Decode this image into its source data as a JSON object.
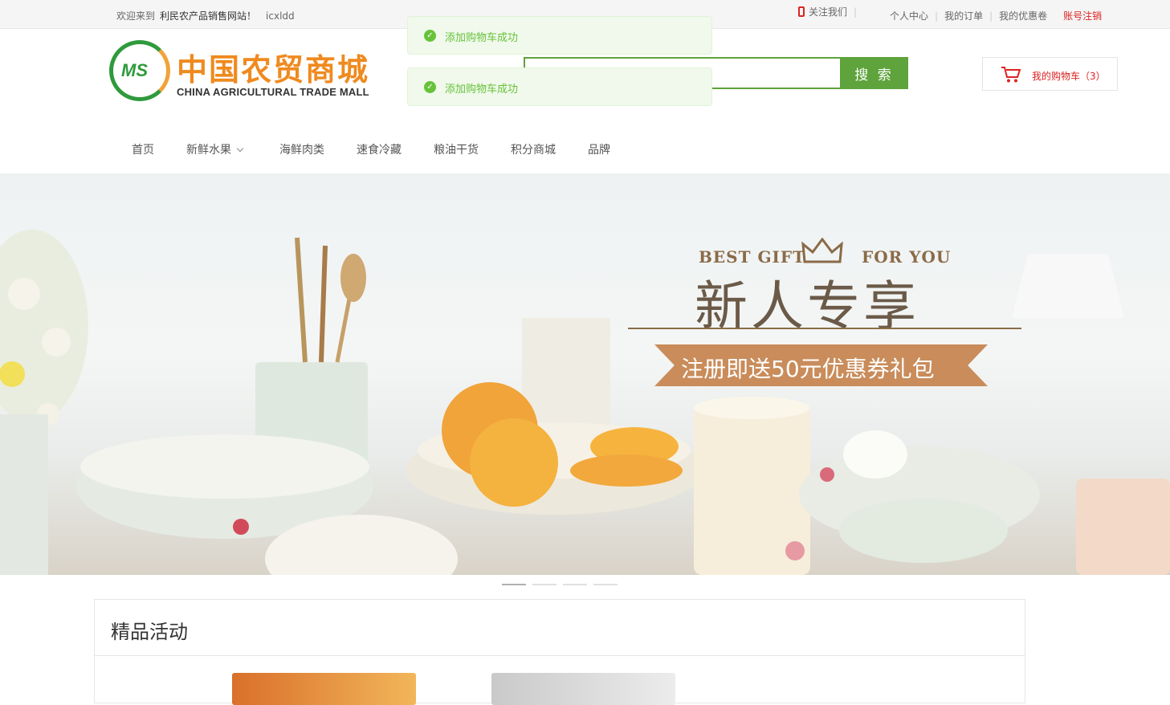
{
  "topbar": {
    "welcome": "欢迎来到",
    "site_name": "利民农产品销售网站！",
    "username": "icxldd",
    "follow": "关注我们",
    "links": [
      "个人中心",
      "我的订单",
      "我的优惠卷"
    ],
    "logout": "账号注销"
  },
  "logo": {
    "badge": "MS",
    "title": "中国农贸商城",
    "subtitle": "CHINA AGRICULTURAL TRADE MALL"
  },
  "search": {
    "button": "搜 索",
    "value": ""
  },
  "cart": {
    "label": "我的购物车（3）"
  },
  "toasts": [
    "添加购物车成功",
    "添加购物车成功"
  ],
  "nav": [
    "首页",
    "新鲜水果",
    "海鲜肉类",
    "速食冷藏",
    "粮油干货",
    "积分商城",
    "品牌"
  ],
  "banner": {
    "left_text": "BEST GIFT",
    "right_text": "FOR YOU",
    "title": "新人专享",
    "ribbon": "注册即送50元优惠券礼包"
  },
  "section": {
    "title": "精品活动"
  }
}
